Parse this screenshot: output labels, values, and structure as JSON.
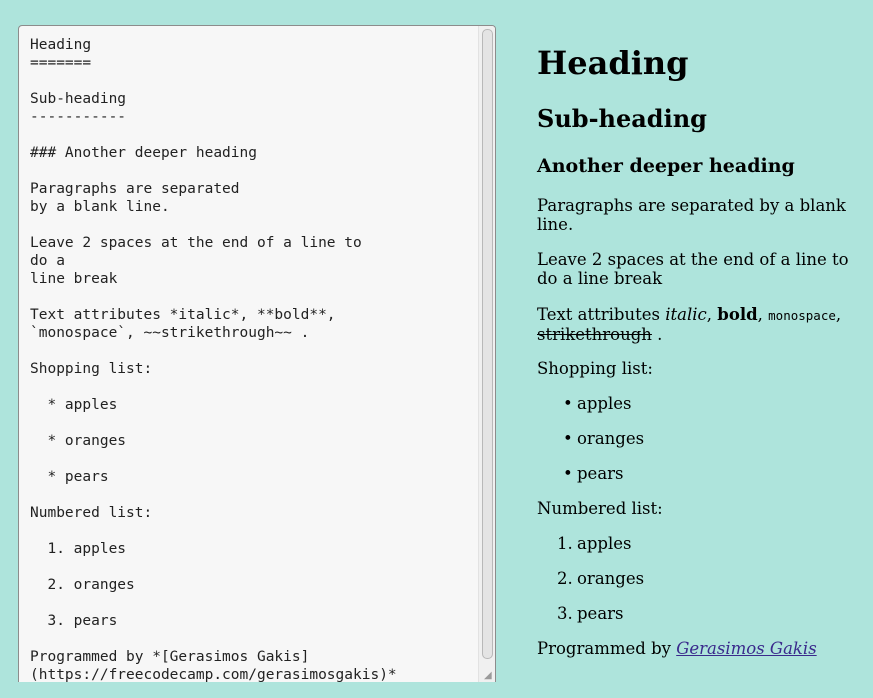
{
  "editor": {
    "text": "Heading\n=======\n\nSub-heading\n-----------\n\n### Another deeper heading\n\nParagraphs are separated\nby a blank line.\n\nLeave 2 spaces at the end of a line to\ndo a\nline break\n\nText attributes *italic*, **bold**,\n`monospace`, ~~strikethrough~~ .\n\nShopping list:\n\n  * apples\n\n  * oranges\n\n  * pears\n\nNumbered list:\n\n  1. apples\n\n  2. oranges\n\n  3. pears\n\nProgrammed by *[Gerasimos Gakis]\n(https://freecodecamp.com/gerasimosgakis)*"
  },
  "preview": {
    "h1": "Heading",
    "h2": "Sub-heading",
    "h3": "Another deeper heading",
    "p_paragraphs": "Paragraphs are separated by a blank line.",
    "p_break_1": "Leave 2 spaces at the end of a line to",
    "p_break_2": "do a line break",
    "attr_prefix": "Text attributes ",
    "attr_italic": "italic",
    "attr_sep1": ", ",
    "attr_bold": "bold",
    "attr_sep2": ", ",
    "attr_mono": "monospace",
    "attr_sep3": ",",
    "attr_strike": "strikethrough",
    "attr_end": " .",
    "shopping_label": "Shopping list:",
    "shopping_items": [
      "apples",
      "oranges",
      "pears"
    ],
    "numbered_label": "Numbered list:",
    "numbered_items": [
      "apples",
      "oranges",
      "pears"
    ],
    "numbered_markers": [
      "1.",
      "2.",
      "3."
    ],
    "bullet": "•",
    "credit_prefix": "Programmed by ",
    "credit_link": "Gerasimos Gakis"
  }
}
